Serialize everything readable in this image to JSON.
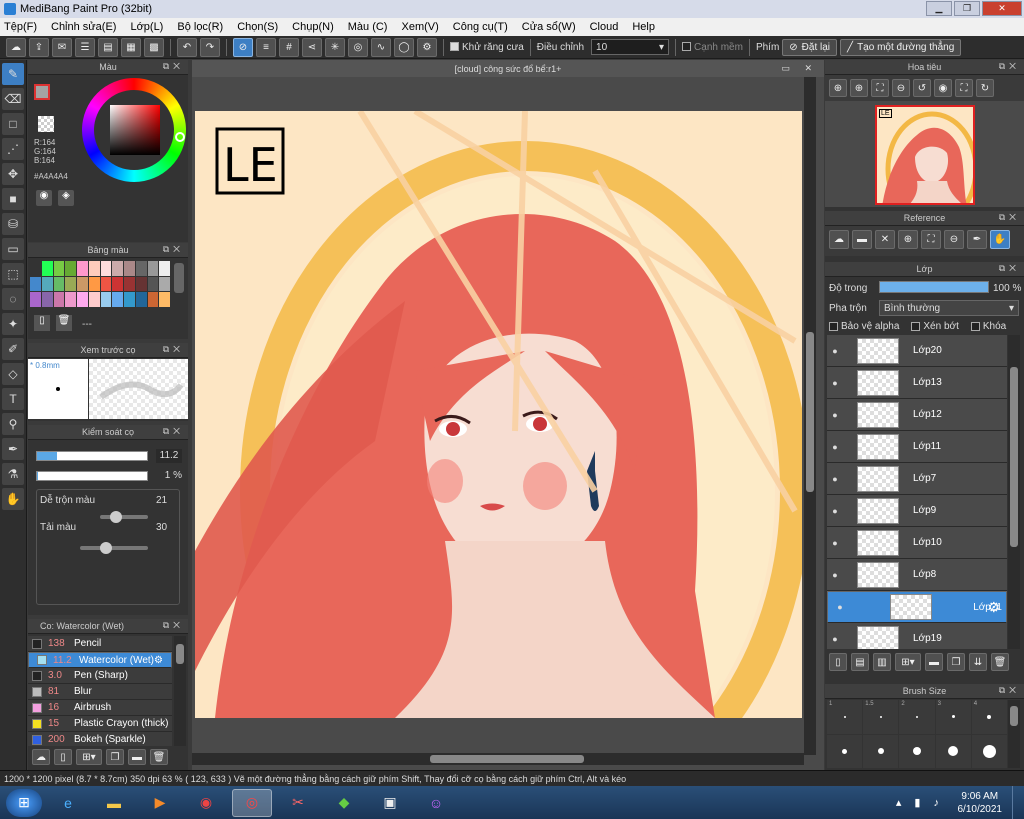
{
  "window": {
    "title": "MediBang Paint Pro (32bit)"
  },
  "menu": [
    "Tệp(F)",
    "Chỉnh sửa(E)",
    "Lớp(L)",
    "Bộ lọc(R)",
    "Chọn(S)",
    "Chụp(N)",
    "Màu (C)",
    "Xem(V)",
    "Công cụ(T)",
    "Cửa sổ(W)",
    "Cloud",
    "Help"
  ],
  "toolbar": {
    "antialias_label": "Khử răng cưa",
    "adjust_label": "Điều chỉnh",
    "adjust_value": "10",
    "edge_label": "Cạnh mềm",
    "key_label": "Phím",
    "reset_label": "Đặt lại",
    "straight_label": "Tạo một đường thẳng"
  },
  "color_panel": {
    "title": "Màu",
    "r": "R:164",
    "g": "G:164",
    "b": "B:164",
    "hex": "#A4A4A4"
  },
  "palette_panel": {
    "title": "Bảng màu",
    "placeholder": "---"
  },
  "preview_panel": {
    "title": "Xem trước cọ",
    "size": "0.8mm"
  },
  "brush_control": {
    "title": "Kiểm soát cọ",
    "size": "11.2",
    "opacity": "1 %",
    "blend_label": "Dễ trộn màu",
    "blend_value": "21",
    "refill_label": "Tải màu",
    "refill_value": "30",
    "size_fill": 0.18,
    "opacity_fill": 0.01,
    "blend_fill": 0.2,
    "refill_fill": 0.3
  },
  "brush_list": {
    "title": "Co: Watercolor (Wet)",
    "items": [
      {
        "size": "138",
        "name": "Pencil",
        "color": "#222222"
      },
      {
        "size": "11.2",
        "name": "Watercolor (Wet)",
        "color": "#a4dff0"
      },
      {
        "size": "3.0",
        "name": "Pen (Sharp)",
        "color": "#222222"
      },
      {
        "size": "81",
        "name": "Blur",
        "color": "#bbbbbb"
      },
      {
        "size": "16",
        "name": "Airbrush",
        "color": "#f4a0e0"
      },
      {
        "size": "15",
        "name": "Plastic Crayon (thick)",
        "color": "#f4e020"
      },
      {
        "size": "200",
        "name": "Bokeh (Sparkle)",
        "color": "#3060e0"
      }
    ]
  },
  "document": {
    "tab": "[cloud] công sức đổ bể:r1+",
    "logo": "LE"
  },
  "navigator": {
    "title": "Hoa tiêu",
    "logo": "LE"
  },
  "reference": {
    "title": "Reference"
  },
  "layers": {
    "title": "Lớp",
    "opacity_label": "Độ trong",
    "opacity_value": "100 %",
    "opacity_fill": 1.0,
    "blend_label": "Pha trộn",
    "blend_value": "Bình thường",
    "protect_alpha": "Bảo vệ alpha",
    "clipping": "Xén bớt",
    "lock": "Khóa",
    "items": [
      "Lớp20",
      "Lớp13",
      "Lớp12",
      "Lớp11",
      "Lớp7",
      "Lớp9",
      "Lớp10",
      "Lớp8",
      "Lớp21",
      "Lớp19"
    ],
    "selected": "Lớp21"
  },
  "brush_size": {
    "title": "Brush Size",
    "labels": [
      "1",
      "1.5",
      "2",
      "3",
      "4"
    ]
  },
  "status": {
    "size": "1200 * 1200 pixel",
    "cm": "(8.7 * 8.7cm)",
    "dpi": "350 dpi",
    "zoom": "63 %",
    "coords": "( 123, 633 )",
    "hint": "Vẽ một đường thẳng bằng cách giữ phím Shift, Thay đổi cỡ cọ bằng cách giữ phím Ctrl, Alt và kéo"
  },
  "taskbar": {
    "time": "9:06 AM",
    "date": "6/10/2021"
  },
  "colors": {
    "accent": "#3d8ad6",
    "hair": "#e8675a",
    "bg": "#fde6c4"
  }
}
